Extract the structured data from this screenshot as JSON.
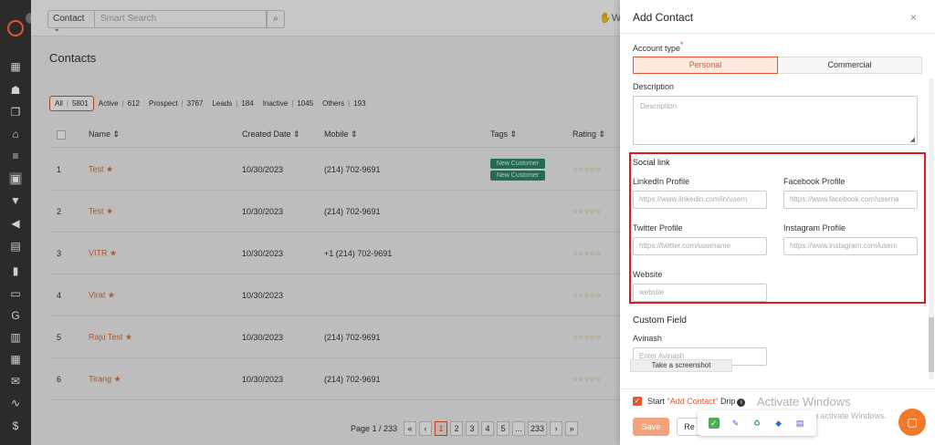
{
  "topbar": {
    "search_type": "Contact",
    "search_placeholder": "Smart Search",
    "truncated_label": "W"
  },
  "page": {
    "title": "Contacts"
  },
  "filters": [
    {
      "label": "All",
      "count": "5801",
      "active": true
    },
    {
      "label": "Active",
      "count": "612",
      "active": false
    },
    {
      "label": "Prospect",
      "count": "3767",
      "active": false
    },
    {
      "label": "Leads",
      "count": "184",
      "active": false
    },
    {
      "label": "Inactive",
      "count": "1045",
      "active": false
    },
    {
      "label": "Others",
      "count": "193",
      "active": false
    }
  ],
  "table": {
    "headers": {
      "name": "Name ⇕",
      "created": "Created Date ⇕",
      "mobile": "Mobile ⇕",
      "tags": "Tags ⇕",
      "rating": "Rating ⇕"
    },
    "rows": [
      {
        "num": "1",
        "name": "Test ★",
        "date": "10/30/2023",
        "mobile": "(214) 702-9691",
        "tags": [
          "New Customer",
          "New Customer"
        ],
        "rating": "☆☆☆☆☆"
      },
      {
        "num": "2",
        "name": "Test ★",
        "date": "10/30/2023",
        "mobile": "(214) 702-9691",
        "tags": [],
        "rating": "☆☆☆☆☆"
      },
      {
        "num": "3",
        "name": "VITR ★",
        "date": "10/30/2023",
        "mobile": "+1 (214) 702-9691",
        "tags": [],
        "rating": "☆☆☆☆☆"
      },
      {
        "num": "4",
        "name": "Virat ★",
        "date": "10/30/2023",
        "mobile": "",
        "tags": [],
        "rating": "☆☆☆☆☆"
      },
      {
        "num": "5",
        "name": "Raju Test ★",
        "date": "10/30/2023",
        "mobile": "(214) 702-9691",
        "tags": [],
        "rating": "☆☆☆☆☆"
      },
      {
        "num": "6",
        "name": "Tirang ★",
        "date": "10/30/2023",
        "mobile": "(214) 702-9691",
        "tags": [],
        "rating": "☆☆☆☆☆"
      }
    ]
  },
  "pager": {
    "label": "Page 1 / 233",
    "first": "«",
    "prev": "‹",
    "pages": [
      "1",
      "2",
      "3",
      "4",
      "5",
      "...",
      "233"
    ],
    "next": "›",
    "last": "»"
  },
  "drawer": {
    "title": "Add Contact",
    "close": "×",
    "account_type_label": "Account type",
    "account_types": [
      "Personal",
      "Commercial"
    ],
    "description_label": "Description",
    "description_placeholder": "Description",
    "social": {
      "title": "Social link",
      "linkedin_label": "LinkedIn Profile",
      "linkedin_placeholder": "https://www.linkedin.com/in/usern",
      "facebook_label": "Facebook Profile",
      "facebook_placeholder": "https://www.facebook.com/userna",
      "twitter_label": "Twitter Profile",
      "twitter_placeholder": "https://twitter.com/username",
      "instagram_label": "Instagram Profile",
      "instagram_placeholder": "https://www.instagram.com/usern",
      "website_label": "Website",
      "website_placeholder": "website"
    },
    "custom": {
      "title": "Custom Field",
      "field_label": "Avinash",
      "field_placeholder": "Enter Avinash"
    },
    "tooltip": "Take a screenshot",
    "drip": {
      "prefix": "Start ",
      "accent": "\"Add Contact\"",
      "suffix": " Drip"
    },
    "save": "Save",
    "reset": "Re"
  },
  "windows": {
    "activate_title": "Activate Windows",
    "activate_sub": "Go to Settings to activate Windows."
  },
  "colors": {
    "accent": "#e3552b",
    "highlight": "#e01a1a"
  }
}
